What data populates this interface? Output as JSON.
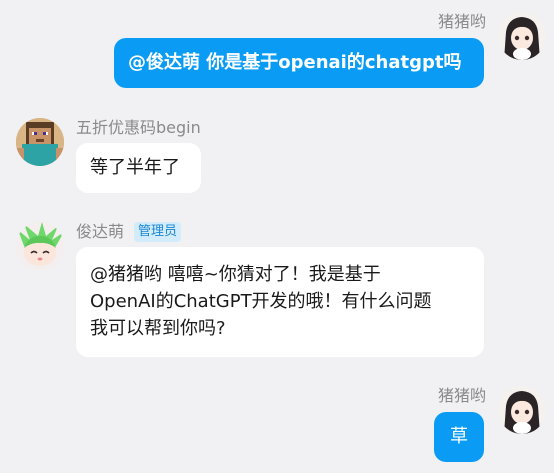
{
  "messages": [
    {
      "sender": "猪猪哟",
      "text": "@俊达萌 你是基于openai的chatgpt吗",
      "side": "right",
      "bubble_color": "#0a9cf5"
    },
    {
      "sender": "五折优惠码begin",
      "text": "等了半年了",
      "side": "left"
    },
    {
      "sender": "俊达萌",
      "badge": "管理员",
      "text_lines": [
        "@猪猪哟 嘻嘻~你猜对了！我是基于",
        "OpenAI的ChatGPT开发的哦！有什么问题",
        "我可以帮到你吗?"
      ],
      "side": "left"
    },
    {
      "sender": "猪猪哟",
      "text": "草",
      "side": "right",
      "bubble_color": "#0a9cf5"
    }
  ],
  "colors": {
    "background": "#f1f1f4",
    "self_bubble": "#0a9cf5",
    "other_bubble": "#ffffff",
    "name_text": "#8a8a8a",
    "badge_bg": "#d3ecfb",
    "badge_text": "#1a87d2"
  }
}
